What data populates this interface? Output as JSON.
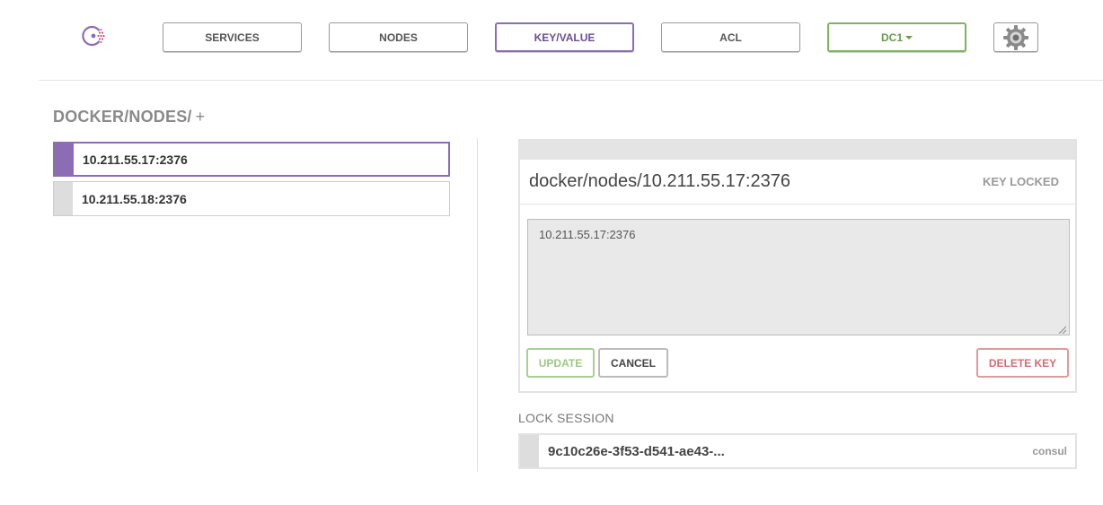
{
  "nav": {
    "logo_icon": "consul-logo-icon",
    "items": [
      {
        "label": "SERVICES",
        "active": false
      },
      {
        "label": "NODES",
        "active": false
      },
      {
        "label": "KEY/VALUE",
        "active": true
      },
      {
        "label": "ACL",
        "active": false
      }
    ],
    "datacenter": {
      "label": "DC1"
    },
    "settings_icon": "gear-icon"
  },
  "breadcrumb": {
    "path": "DOCKER/NODES/",
    "add": "+"
  },
  "keys": [
    {
      "label": "10.211.55.17:2376",
      "selected": true
    },
    {
      "label": "10.211.55.18:2376",
      "selected": false
    }
  ],
  "editor": {
    "title": "docker/nodes/10.211.55.17:2376",
    "lock_status": "KEY LOCKED",
    "value": "10.211.55.17:2376",
    "update_label": "UPDATE",
    "cancel_label": "CANCEL",
    "delete_label": "DELETE KEY"
  },
  "lock_session": {
    "heading": "LOCK SESSION",
    "id": "9c10c26e-3f53-d541-ae43-...",
    "node": "consul"
  },
  "colors": {
    "accent": "#8c6cb3",
    "datacenter": "#7fb35e",
    "danger": "#d56b72"
  }
}
